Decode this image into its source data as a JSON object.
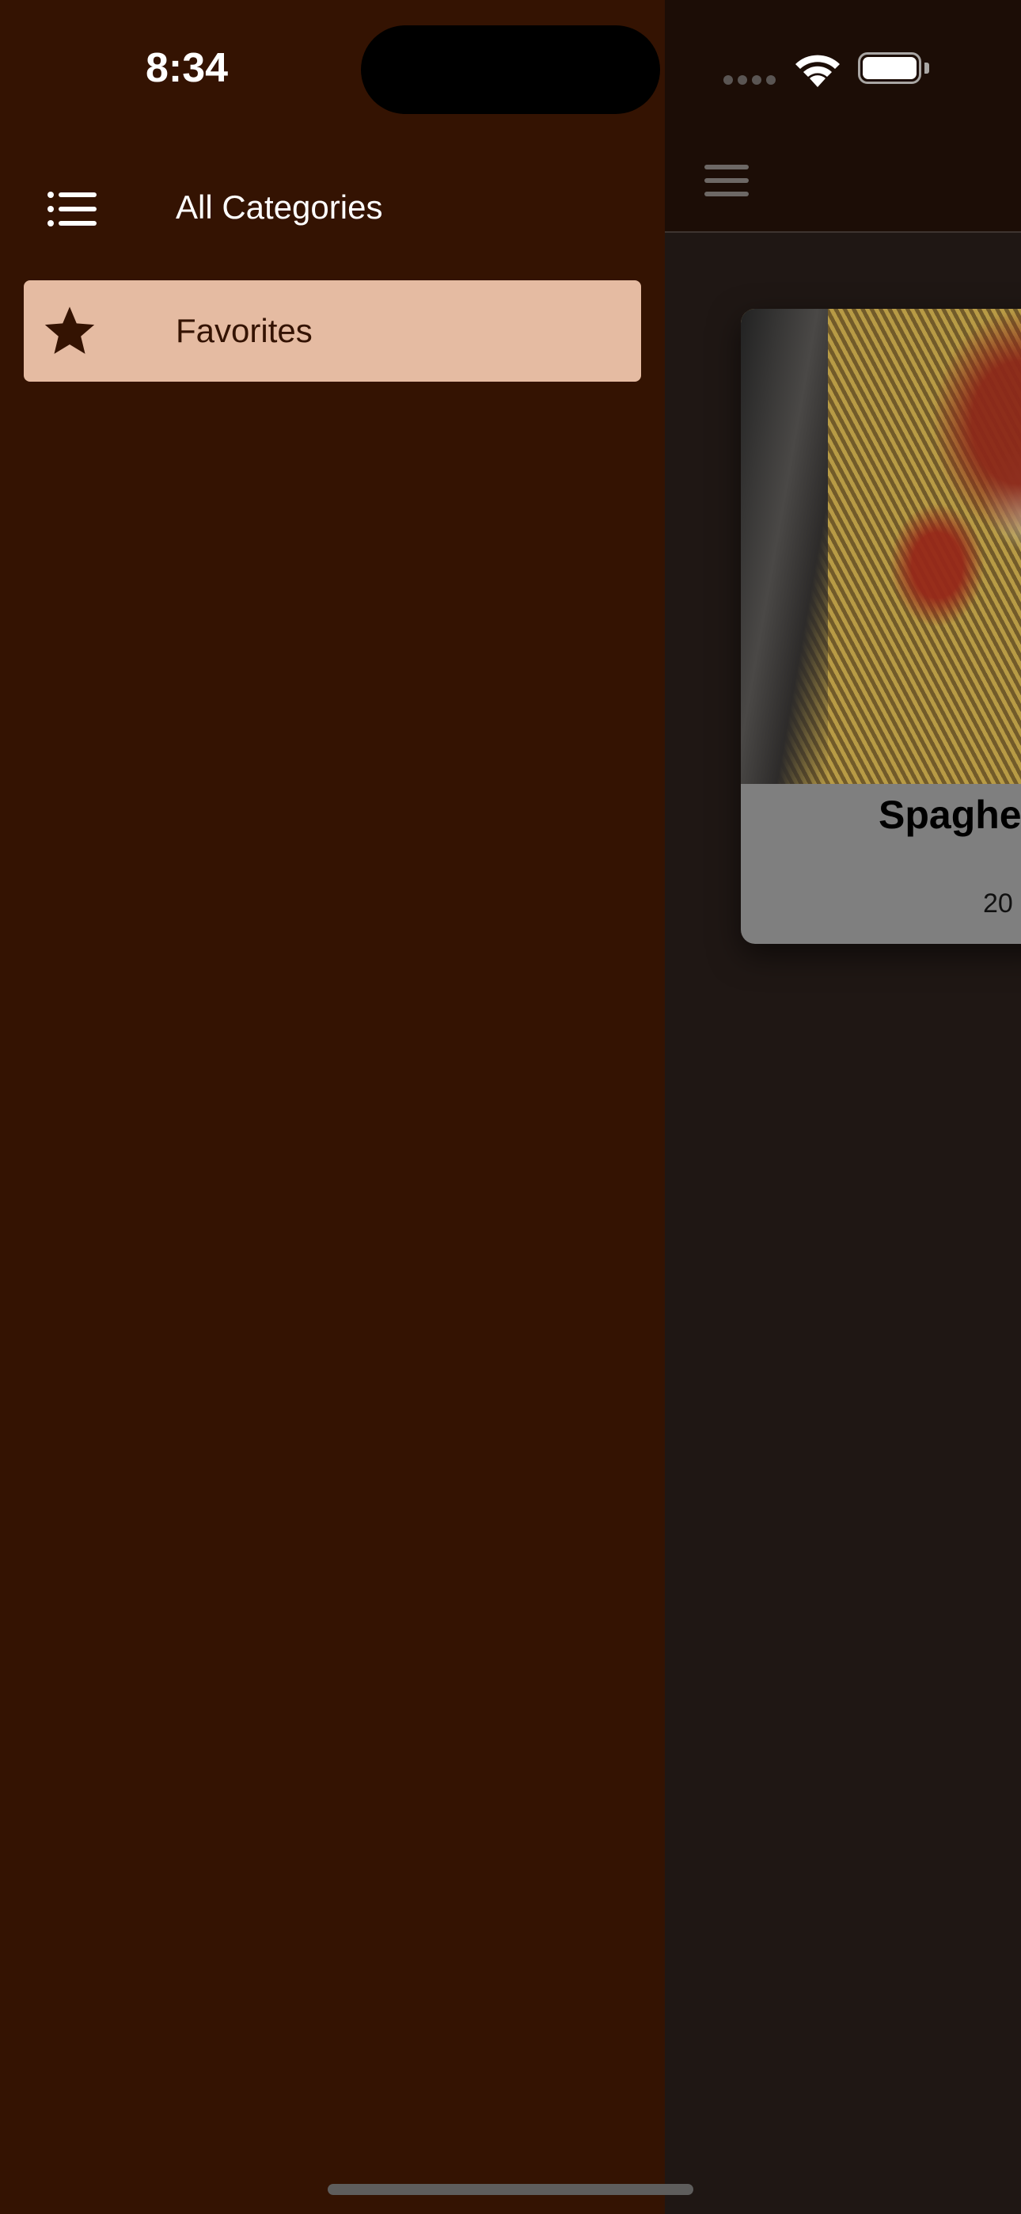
{
  "status_bar": {
    "time": "8:34"
  },
  "drawer": {
    "header": {
      "icon": "list-icon",
      "title": "All Categories"
    },
    "items": [
      {
        "icon": "star-icon",
        "label": "Favorites",
        "selected": true
      }
    ]
  },
  "main": {
    "header": {
      "menu_icon": "hamburger-menu-icon"
    },
    "meal_card": {
      "title": "Spaghe",
      "meta": "20"
    }
  },
  "colors": {
    "drawer_background": "#341302",
    "selected_item_background": "#e5bba2",
    "selected_item_text": "#341302",
    "header_text": "#ffffff"
  }
}
